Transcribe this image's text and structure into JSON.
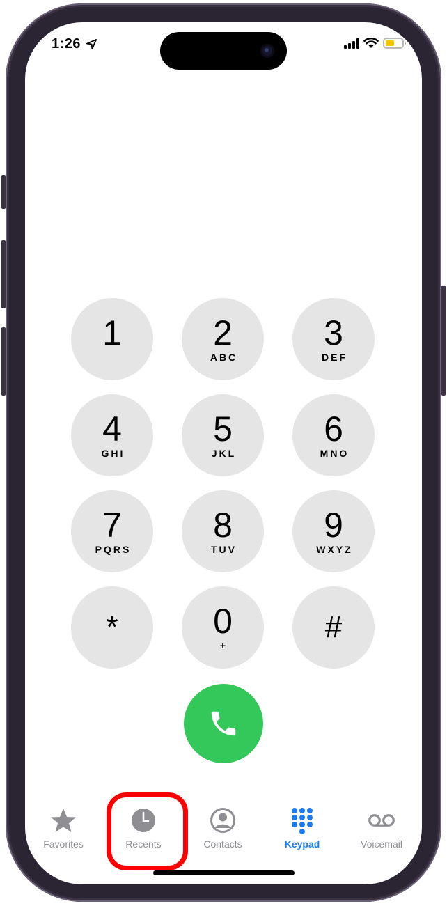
{
  "status_bar": {
    "time": "1:26",
    "icons": [
      "location-arrow-icon",
      "cellular-signal-icon",
      "wifi-icon",
      "battery-icon"
    ],
    "battery_color": "#f5c400",
    "battery_level": 0.55
  },
  "keypad": {
    "keys": [
      {
        "digit": "1",
        "letters": ""
      },
      {
        "digit": "2",
        "letters": "ABC"
      },
      {
        "digit": "3",
        "letters": "DEF"
      },
      {
        "digit": "4",
        "letters": "GHI"
      },
      {
        "digit": "5",
        "letters": "JKL"
      },
      {
        "digit": "6",
        "letters": "MNO"
      },
      {
        "digit": "7",
        "letters": "PQRS"
      },
      {
        "digit": "8",
        "letters": "TUV"
      },
      {
        "digit": "9",
        "letters": "WXYZ"
      },
      {
        "digit": "*",
        "letters": ""
      },
      {
        "digit": "0",
        "letters": "+"
      },
      {
        "digit": "#",
        "letters": ""
      }
    ],
    "key_color": "#e5e5e5"
  },
  "call_button": {
    "icon": "phone-icon",
    "color": "#34c759"
  },
  "tab_bar": {
    "tabs": [
      {
        "label": "Favorites",
        "icon": "star-icon"
      },
      {
        "label": "Recents",
        "icon": "clock-icon"
      },
      {
        "label": "Contacts",
        "icon": "person-circle-icon"
      },
      {
        "label": "Keypad",
        "icon": "keypad-grid-icon"
      },
      {
        "label": "Voicemail",
        "icon": "voicemail-icon"
      }
    ],
    "active_tab": "Keypad",
    "active_color": "#1a7cf5",
    "inactive_color": "#8e8e93",
    "highlight_color": "#ff0000"
  }
}
